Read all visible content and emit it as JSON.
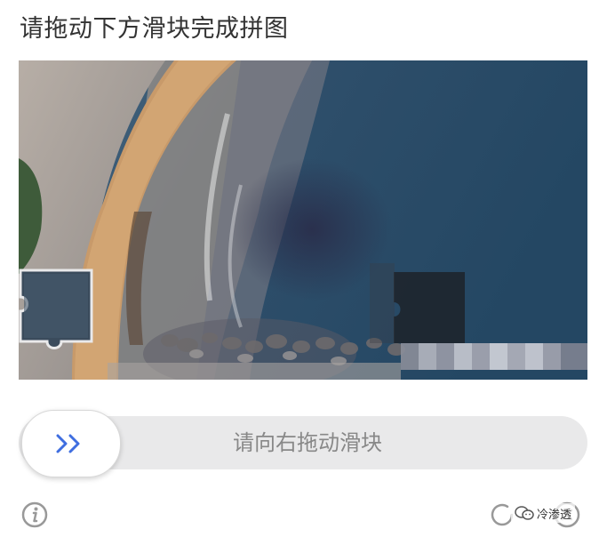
{
  "captcha": {
    "title": "请拖动下方滑块完成拼图",
    "image": {
      "description_icon": "coastline-aerial-photo"
    },
    "slider": {
      "hint": "请向右拖动滑块",
      "handle_icon": "double-chevron-right-icon",
      "accent_color": "#3f6ee0"
    },
    "footer": {
      "info_icon": "info-icon",
      "refresh_icon": "refresh-icon",
      "close_icon": "close-icon"
    },
    "watermark": {
      "text": "冷渗透"
    }
  }
}
